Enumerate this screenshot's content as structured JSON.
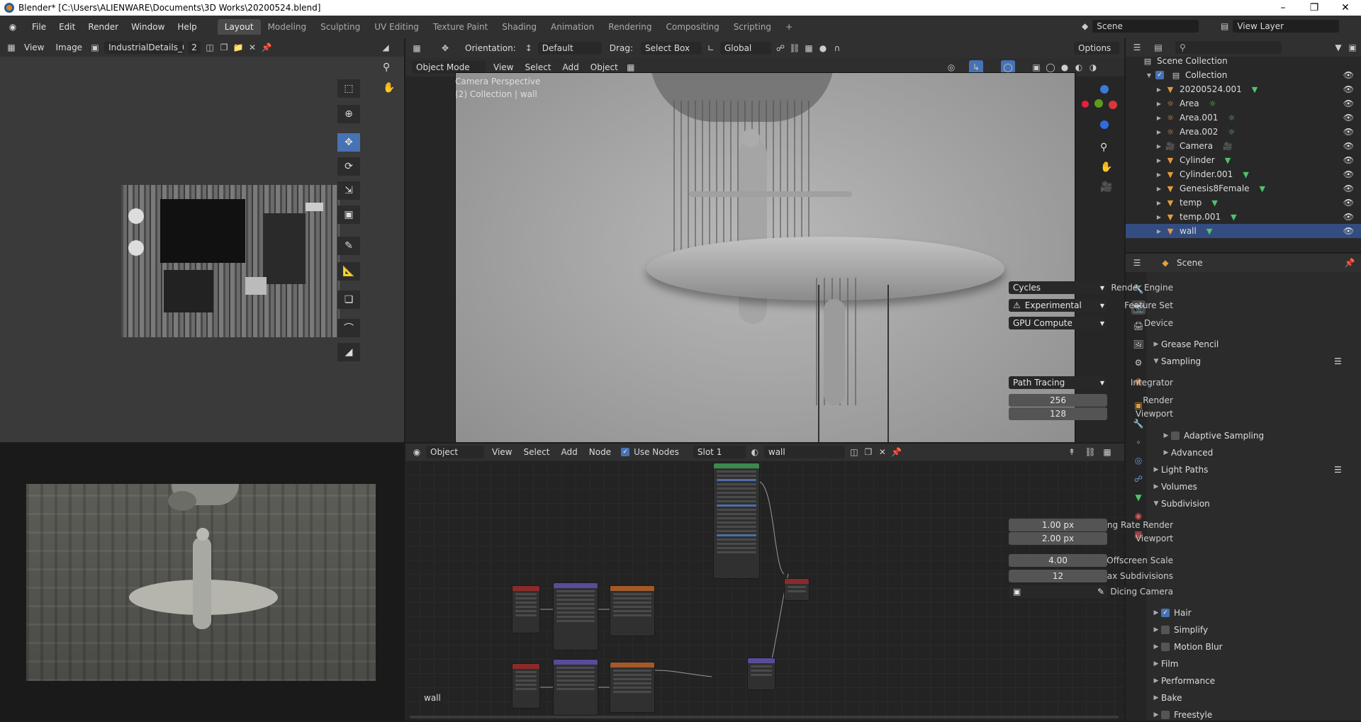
{
  "window": {
    "title": "Blender* [C:\\Users\\ALIENWARE\\Documents\\3D Works\\20200524.blend]"
  },
  "menu": [
    "File",
    "Edit",
    "Render",
    "Window",
    "Help"
  ],
  "workspaces": [
    "Layout",
    "Modeling",
    "Sculpting",
    "UV Editing",
    "Texture Paint",
    "Shading",
    "Animation",
    "Rendering",
    "Compositing",
    "Scripting"
  ],
  "active_workspace": "Layout",
  "scene": {
    "name": "Scene",
    "view_layer": "View Layer"
  },
  "image_editor": {
    "view": "View",
    "image": "Image",
    "image_name": "IndustrialDetails_02...",
    "users": "2"
  },
  "viewport_toolbar": {
    "orientation_label": "Orientation:",
    "orientation": "Default",
    "drag_label": "Drag:",
    "drag": "Select Box",
    "transform": "Global",
    "options": "Options"
  },
  "viewport_header": {
    "mode": "Object Mode",
    "view": "View",
    "select": "Select",
    "add": "Add",
    "object": "Object"
  },
  "viewport": {
    "camera_label": "Camera Perspective",
    "collection_label": "(2) Collection | wall"
  },
  "node_editor": {
    "type": "Object",
    "view": "View",
    "select": "Select",
    "add": "Add",
    "node": "Node",
    "use_nodes": "Use Nodes",
    "slot": "Slot 1",
    "material": "wall",
    "label": "wall"
  },
  "outliner": {
    "root": "Scene Collection",
    "collection": "Collection",
    "items": [
      {
        "name": "20200524.001",
        "icon": "mesh"
      },
      {
        "name": "Area",
        "icon": "light"
      },
      {
        "name": "Area.001",
        "icon": "light"
      },
      {
        "name": "Area.002",
        "icon": "light"
      },
      {
        "name": "Camera",
        "icon": "camera"
      },
      {
        "name": "Cylinder",
        "icon": "mesh"
      },
      {
        "name": "Cylinder.001",
        "icon": "mesh"
      },
      {
        "name": "Genesis8Female",
        "icon": "mesh"
      },
      {
        "name": "temp",
        "icon": "mesh"
      },
      {
        "name": "temp.001",
        "icon": "mesh"
      },
      {
        "name": "wall",
        "icon": "mesh"
      }
    ],
    "selected": "wall"
  },
  "properties": {
    "context": "Scene",
    "render_engine_label": "Render Engine",
    "render_engine": "Cycles",
    "feature_set_label": "Feature Set",
    "feature_set": "Experimental",
    "device_label": "Device",
    "device": "GPU Compute",
    "panels": {
      "grease_pencil": "Grease Pencil",
      "sampling": "Sampling",
      "adaptive_sampling": "Adaptive Sampling",
      "advanced": "Advanced",
      "light_paths": "Light Paths",
      "volumes": "Volumes",
      "subdivision": "Subdivision",
      "hair": "Hair",
      "simplify": "Simplify",
      "motion_blur": "Motion Blur",
      "film": "Film",
      "performance": "Performance",
      "bake": "Bake",
      "freestyle": "Freestyle"
    },
    "integrator_label": "Integrator",
    "integrator": "Path Tracing",
    "render_label": "Render",
    "render_samples": "256",
    "viewport_label": "Viewport",
    "viewport_samples": "128",
    "dicing_rate_render_label": "Dicing Rate Render",
    "dicing_rate_render": "1.00 px",
    "dicing_viewport_label": "Viewport",
    "dicing_viewport": "2.00 px",
    "offscreen_scale_label": "Offscreen Scale",
    "offscreen_scale": "4.00",
    "max_subdivisions_label": "Max Subdivisions",
    "max_subdivisions": "12",
    "dicing_camera_label": "Dicing Camera"
  },
  "colors": {
    "accent": "#4772b3",
    "selected_row": "#334d80",
    "object_orange": "#e39c3c"
  }
}
